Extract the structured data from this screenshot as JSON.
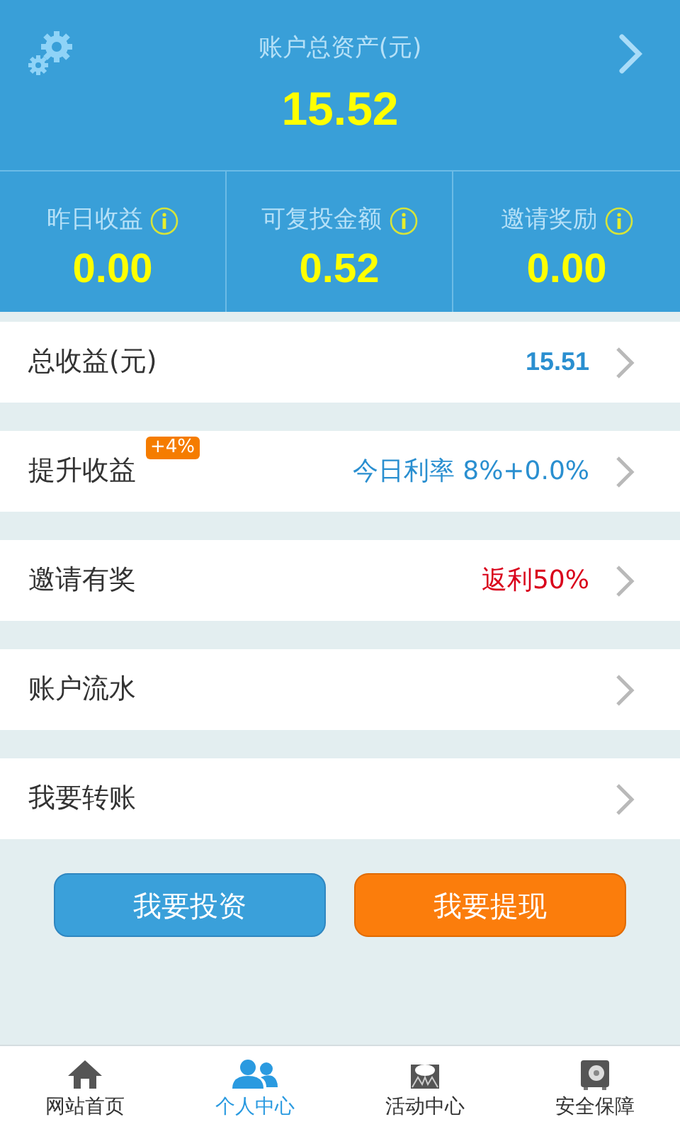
{
  "header": {
    "title": "账户总资产(元)",
    "total": "15.52"
  },
  "stats": [
    {
      "label": "昨日收益",
      "value": "0.00"
    },
    {
      "label": "可复投金额",
      "value": "0.52"
    },
    {
      "label": "邀请奖励",
      "value": "0.00"
    }
  ],
  "menu": [
    {
      "label": "总收益(元)",
      "value": "15.51",
      "color": "#2a8fd0",
      "bold": true
    },
    {
      "label": "提升收益",
      "badge": "+4%",
      "value": "今日利率 8%+0.0%",
      "color": "#2a8fd0",
      "bold": false
    },
    {
      "label": "邀请有奖",
      "value": "返利50%",
      "color": "#d9001b",
      "bold": false
    },
    {
      "label": "账户流水"
    },
    {
      "label": "我要转账"
    }
  ],
  "buttons": [
    {
      "label": "我要投资",
      "kind": "invest"
    },
    {
      "label": "我要提现",
      "kind": "withdraw"
    }
  ],
  "tabs": [
    {
      "label": "网站首页",
      "kind": "home",
      "selected": false
    },
    {
      "label": "个人中心",
      "kind": "users",
      "selected": true
    },
    {
      "label": "活动中心",
      "kind": "event",
      "selected": false
    },
    {
      "label": "安全保障",
      "kind": "safe",
      "selected": false
    }
  ]
}
